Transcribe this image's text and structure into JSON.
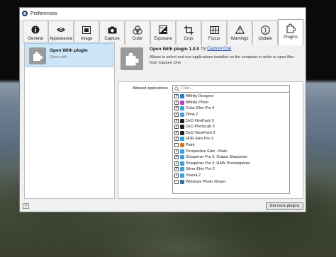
{
  "window": {
    "title": "Preferences"
  },
  "tabs": [
    {
      "label": "General",
      "icon": "info-icon"
    },
    {
      "label": "Appearance",
      "icon": "eye-icon"
    },
    {
      "label": "Image",
      "icon": "image-icon"
    },
    {
      "label": "Capture",
      "icon": "camera-icon"
    },
    {
      "label": "Color",
      "icon": "color-circles-icon"
    },
    {
      "label": "Exposure",
      "icon": "exposure-icon"
    },
    {
      "label": "Crop",
      "icon": "crop-icon"
    },
    {
      "label": "Focus",
      "icon": "focus-grid-icon"
    },
    {
      "label": "Warnings",
      "icon": "warning-icon"
    },
    {
      "label": "Update",
      "icon": "update-icon"
    },
    {
      "label": "Plugins",
      "icon": "puzzle-icon"
    }
  ],
  "active_tab": "Plugins",
  "plugin_list": [
    {
      "name": "Open With plugin",
      "subtitle": "Open with"
    }
  ],
  "plugin_detail": {
    "title": "Open With plugin 1.0.0",
    "by_prefix": "by",
    "author": "Capture One",
    "description": "Allows to select and use applications installed on the computer in order to open files from Capture One",
    "allowed_label": "Allowed applications",
    "search_placeholder": "Filter...",
    "apps": [
      {
        "name": "Affinity Designer",
        "checked": true,
        "color": "#1e7fd0"
      },
      {
        "name": "Affinity Photo",
        "checked": true,
        "color": "#b83bd6"
      },
      {
        "name": "Color Efex Pro 4",
        "checked": true,
        "color": "#3fa3e0"
      },
      {
        "name": "Dfine 2",
        "checked": true,
        "color": "#4a9fd8"
      },
      {
        "name": "DxO FilmPack 5",
        "checked": true,
        "color": "#222222"
      },
      {
        "name": "DxO PhotoLab 3",
        "checked": true,
        "color": "#222222"
      },
      {
        "name": "DxO ViewPoint 3",
        "checked": true,
        "color": "#222222"
      },
      {
        "name": "HDR Efex Pro 2",
        "checked": true,
        "color": "#35a0e0"
      },
      {
        "name": "Paint",
        "checked": false,
        "color": "#d07a2a"
      },
      {
        "name": "Perspective Efex - Main",
        "checked": true,
        "color": "#3b9ee0"
      },
      {
        "name": "Sharpener Pro 3: Output Sharpener",
        "checked": true,
        "color": "#3b9ee0"
      },
      {
        "name": "Sharpener Pro 3: RAW Presharpener",
        "checked": true,
        "color": "#3b9ee0"
      },
      {
        "name": "Silver Efex Pro 2",
        "checked": true,
        "color": "#3b9ee0"
      },
      {
        "name": "Viveza 2",
        "checked": true,
        "color": "#3b9ee0"
      },
      {
        "name": "Windows Photo Viewer",
        "checked": false,
        "color": "#3a6fb0"
      }
    ]
  },
  "bottom": {
    "plus_label": "+",
    "more_plugins_label": "Get more plugins"
  }
}
